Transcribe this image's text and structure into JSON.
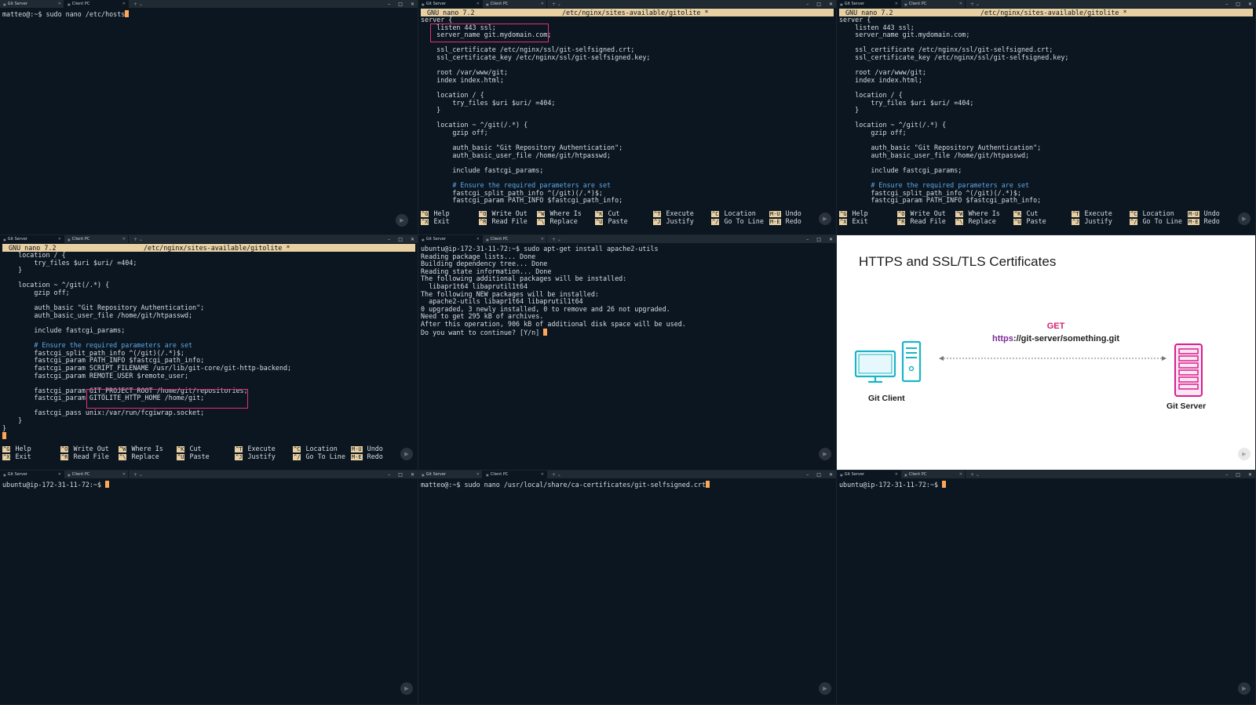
{
  "tabs": {
    "git_server": "Git Server",
    "client_pc": "Client PC"
  },
  "window_controls": [
    "–",
    "□",
    "✕"
  ],
  "panes": {
    "p1": {
      "prompt": "matteo@:~$ ",
      "command": "sudo nano /etc/hosts"
    },
    "nano_version": "GNU nano 7.2",
    "nano_file": "/etc/nginx/sites-available/gitolite *",
    "p2_lines": [
      "server {",
      "    listen 443 ssl;",
      "    server_name git.mydomain.com;",
      "",
      "    ssl_certificate /etc/nginx/ssl/git-selfsigned.crt;",
      "    ssl_certificate_key /etc/nginx/ssl/git-selfsigned.key;",
      "",
      "    root /var/www/git;",
      "    index index.html;",
      "",
      "    location / {",
      "        try_files $uri $uri/ =404;",
      "    }",
      "",
      "    location ~ ^/git(/.*) {",
      "        gzip off;",
      "",
      "        auth_basic \"Git Repository Authentication\";",
      "        auth_basic_user_file /home/git/htpasswd;",
      "",
      "        include fastcgi_params;",
      "",
      "        # Ensure the required parameters are set",
      "        fastcgi_split_path_info ^(/git)(/.*)$;",
      "        fastcgi_param PATH_INFO $fastcgi_path_info;"
    ],
    "p4_lines": [
      "    location / {",
      "        try_files $uri $uri/ =404;",
      "    }",
      "",
      "    location ~ ^/git(/.*) {",
      "        gzip off;",
      "",
      "        auth_basic \"Git Repository Authentication\";",
      "        auth_basic_user_file /home/git/htpasswd;",
      "",
      "        include fastcgi_params;",
      "",
      "        # Ensure the required parameters are set",
      "        fastcgi_split_path_info ^(/git)(/.*)$;",
      "        fastcgi_param PATH_INFO $fastcgi_path_info;",
      "        fastcgi_param SCRIPT_FILENAME /usr/lib/git-core/git-http-backend;",
      "        fastcgi_param REMOTE_USER $remote_user;",
      "",
      "        fastcgi_param GIT_PROJECT_ROOT /home/git/repositories;",
      "        fastcgi_param GITOLITE_HTTP_HOME /home/git;",
      "",
      "        fastcgi_pass unix:/var/run/fcgiwrap.socket;",
      "    }",
      "}"
    ],
    "p5_lines": [
      "ubuntu@ip-172-31-11-72:~$ sudo apt-get install apache2-utils",
      "Reading package lists... Done",
      "Building dependency tree... Done",
      "Reading state information... Done",
      "The following additional packages will be installed:",
      "  libapr1t64 libaprutil1t64",
      "The following NEW packages will be installed:",
      "  apache2-utils libapr1t64 libaprutil1t64",
      "0 upgraded, 3 newly installed, 0 to remove and 26 not upgraded.",
      "Need to get 295 kB of archives.",
      "After this operation, 906 kB of additional disk space will be used.",
      "Do you want to continue? [Y/n] "
    ],
    "p7": {
      "prompt": "ubuntu@ip-172-31-11-72:~$ ",
      "command": ""
    },
    "p8": {
      "prompt": "matteo@:~$ ",
      "command": "sudo nano /usr/local/share/ca-certificates/git-selfsigned.crt"
    },
    "p9": {
      "prompt": "ubuntu@ip-172-31-11-72:~$ ",
      "command": ""
    }
  },
  "nano_keys": [
    {
      "k1": "^G",
      "l1": "Help",
      "k2": "^X",
      "l2": "Exit"
    },
    {
      "k1": "^O",
      "l1": "Write Out",
      "k2": "^R",
      "l2": "Read File"
    },
    {
      "k1": "^W",
      "l1": "Where Is",
      "k2": "^\\",
      "l2": "Replace"
    },
    {
      "k1": "^K",
      "l1": "Cut",
      "k2": "^U",
      "l2": "Paste"
    },
    {
      "k1": "^T",
      "l1": "Execute",
      "k2": "^J",
      "l2": "Justify"
    },
    {
      "k1": "^C",
      "l1": "Location",
      "k2": "^/",
      "l2": "Go To Line"
    },
    {
      "k1": "M-U",
      "l1": "Undo",
      "k2": "M-E",
      "l2": "Redo"
    }
  ],
  "slide": {
    "title": "HTTPS and SSL/TLS Certificates",
    "method": "GET",
    "url_scheme": "https",
    "url_rest": "://git-server/something.git",
    "client_label": "Git Client",
    "server_label": "Git Server",
    "client_color": "#1ab4c8",
    "server_color": "#d61f8f"
  }
}
